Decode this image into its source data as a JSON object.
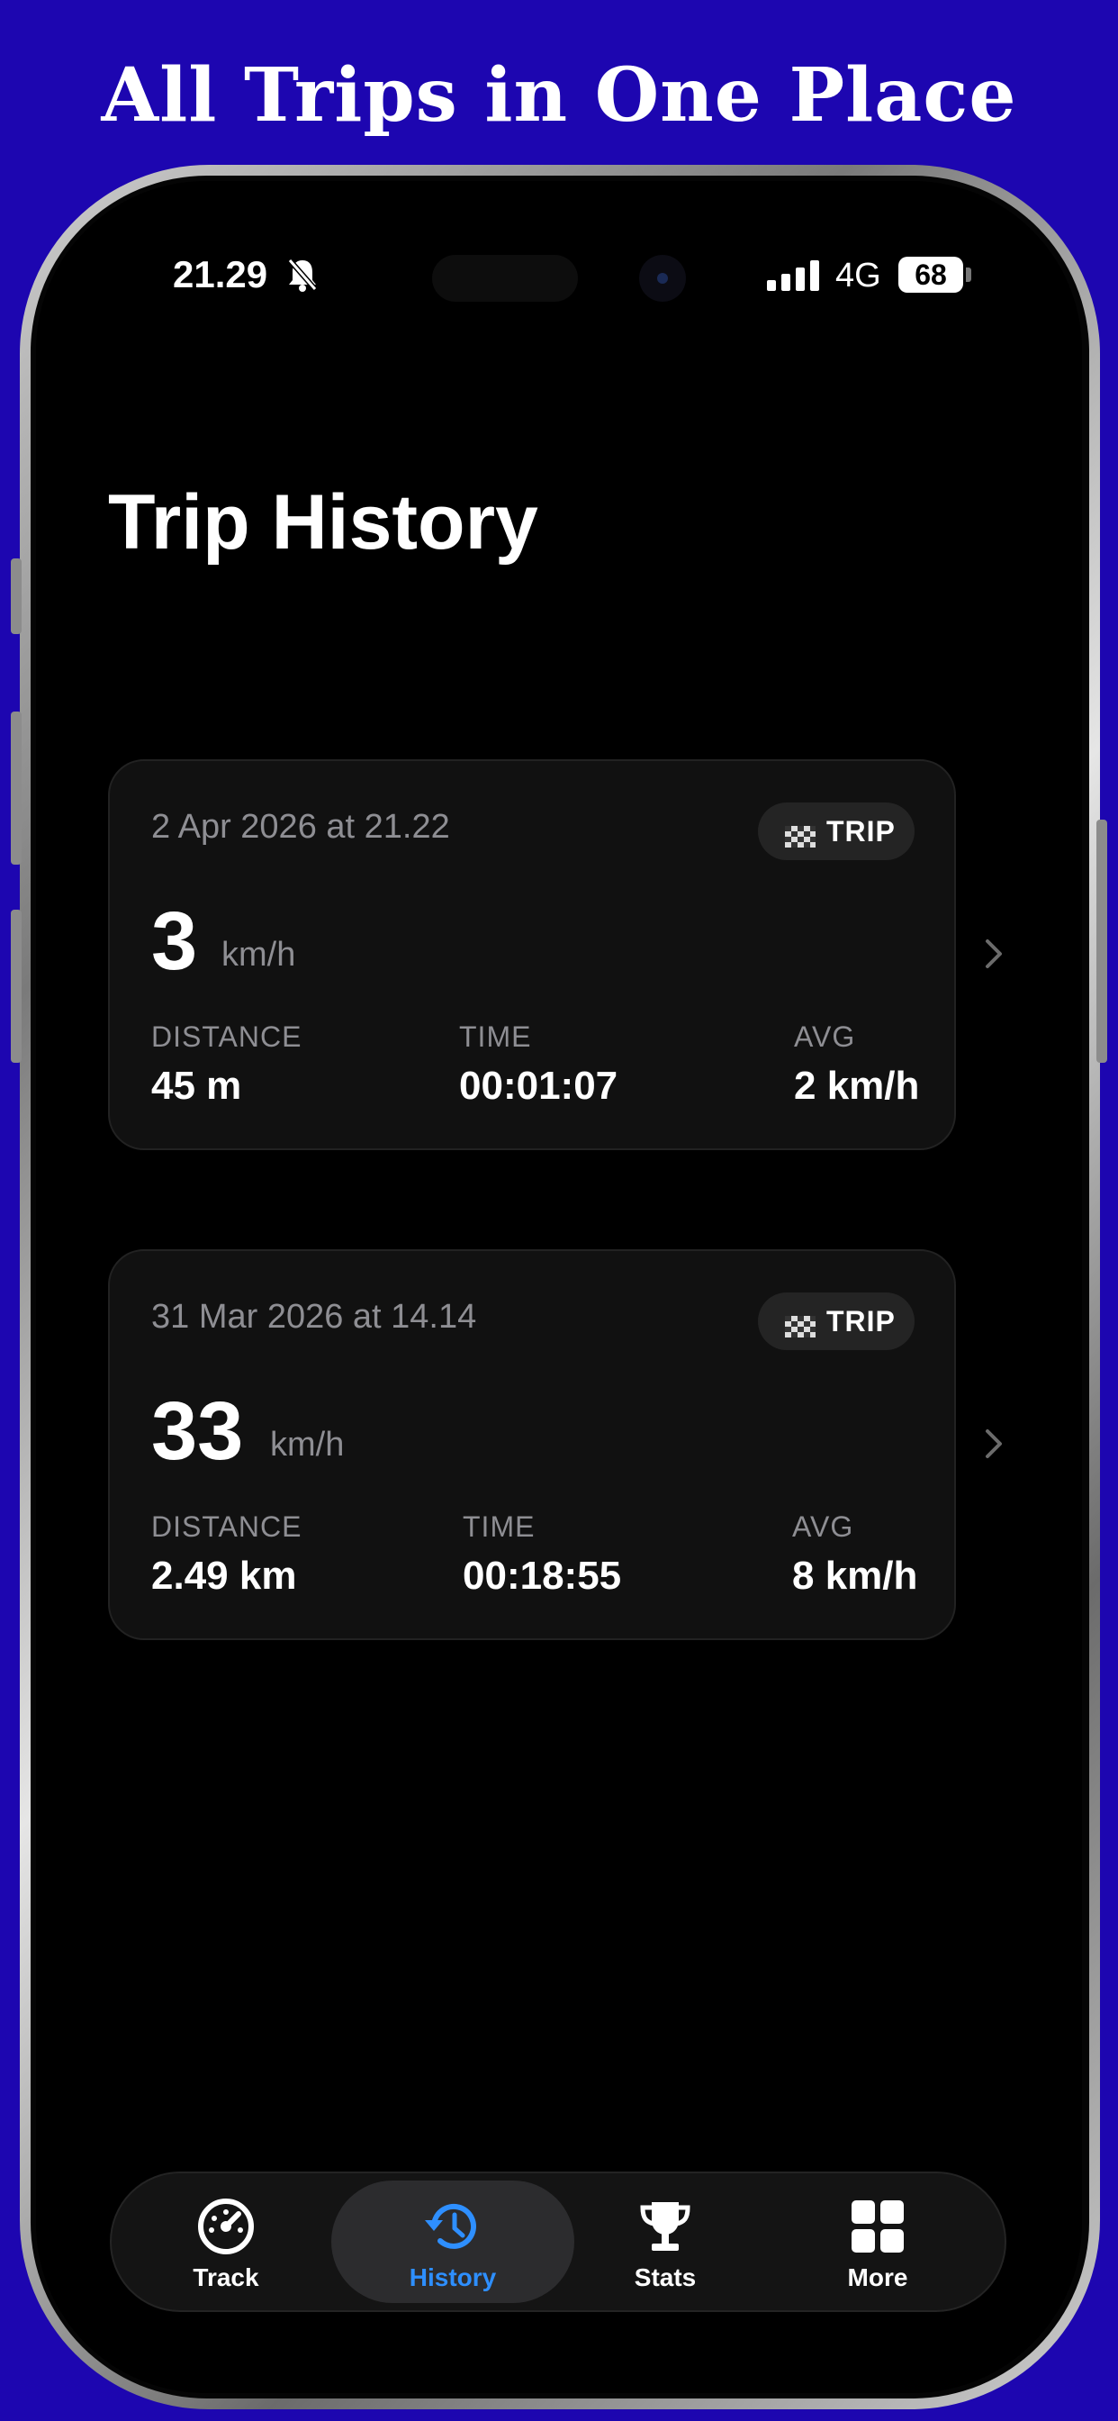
{
  "banner": {
    "headline": "All Trips in One Place"
  },
  "status_bar": {
    "time": "21.29",
    "network": "4G",
    "battery": "68",
    "icons": [
      "bell-slash-icon",
      "signal-icon"
    ]
  },
  "page": {
    "title": "Trip History"
  },
  "trips": [
    {
      "date": "2 Apr 2026 at 21.22",
      "badge": "TRIP",
      "speed": "3",
      "speed_unit": "km/h",
      "distance_label": "DISTANCE",
      "distance": "45 m",
      "time_label": "TIME",
      "time": "00:01:07",
      "avg_label": "AVG",
      "avg": "2 km/h"
    },
    {
      "date": "31 Mar 2026 at 14.14",
      "badge": "TRIP",
      "speed": "33",
      "speed_unit": "km/h",
      "distance_label": "DISTANCE",
      "distance": "2.49 km",
      "time_label": "TIME",
      "time": "00:18:55",
      "avg_label": "AVG",
      "avg": "8 km/h"
    }
  ],
  "tabbar": {
    "active": "History",
    "tabs": [
      {
        "label": "Track",
        "icon": "speedometer-icon"
      },
      {
        "label": "History",
        "icon": "history-clock-icon"
      },
      {
        "label": "Stats",
        "icon": "trophy-icon"
      },
      {
        "label": "More",
        "icon": "grid-icon"
      }
    ]
  },
  "colors": {
    "background": "#1d06b0",
    "accent": "#2e8fff",
    "card": "#111111",
    "muted_text": "#8e8e93"
  }
}
